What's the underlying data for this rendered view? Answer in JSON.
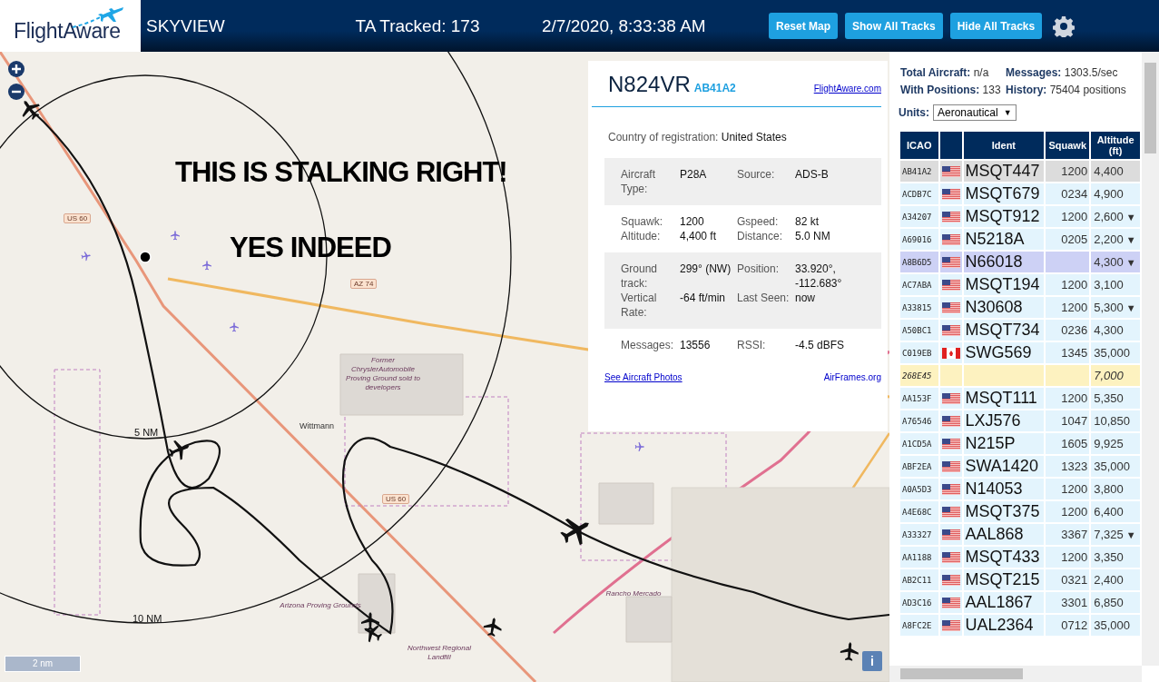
{
  "header": {
    "logo": "FlightAware",
    "title": "SKYVIEW",
    "tracked": "TA Tracked: 173",
    "datetime": "2/7/2020, 8:33:38 AM",
    "buttons": [
      "Reset Map",
      "Show All Tracks",
      "Hide All Tracks"
    ]
  },
  "map": {
    "overlay_texts": [
      "THIS IS STALKING RIGHT!",
      "YES INDEED"
    ],
    "range_labels": [
      "5 NM",
      "10 NM"
    ],
    "labels": [
      {
        "text": "US 60",
        "kind": "road"
      },
      {
        "text": "AZ 74",
        "kind": "road"
      },
      {
        "text": "US 60",
        "kind": "road"
      },
      {
        "text": "Wittmann",
        "kind": "place"
      },
      {
        "text": "Former ChryslerAutomobile Proving Ground sold to developers",
        "kind": "area"
      },
      {
        "text": "Rancho Mercado",
        "kind": "area"
      },
      {
        "text": "Northwest Regional Landfill",
        "kind": "area"
      },
      {
        "text": "Arizona Proving Grounds",
        "kind": "area"
      }
    ],
    "scale": "2 nm",
    "info_button": "i"
  },
  "info_panel": {
    "registration": "N824VR",
    "icao": "AB41A2",
    "link": "FlightAware.com",
    "country_label": "Country of registration:",
    "country": "United States",
    "groups": [
      {
        "shaded": true,
        "fields": [
          {
            "label": "Aircraft Type:",
            "value": "P28A"
          },
          {
            "label": "Source:",
            "value": "ADS-B"
          }
        ]
      },
      {
        "shaded": false,
        "fields": [
          {
            "label": "Squawk:",
            "value": "1200"
          },
          {
            "label": "Gspeed:",
            "value": "82 kt"
          },
          {
            "label": "Altitude:",
            "value": "4,400 ft"
          },
          {
            "label": "Distance:",
            "value": "5.0 NM"
          }
        ]
      },
      {
        "shaded": true,
        "fields": [
          {
            "label": "Ground track:",
            "value": "299° (NW)"
          },
          {
            "label": "Position:",
            "value": "33.920°, -112.683°"
          },
          {
            "label": "Vertical Rate:",
            "value": "-64 ft/min"
          },
          {
            "label": "Last Seen:",
            "value": "now"
          }
        ]
      },
      {
        "shaded": false,
        "fields": [
          {
            "label": "Messages:",
            "value": "13556"
          },
          {
            "label": "RSSI:",
            "value": "-4.5 dBFS"
          }
        ]
      }
    ],
    "photos_link": "See Aircraft Photos",
    "airframes_link": "AirFrames.org"
  },
  "sidebar": {
    "stats": [
      {
        "label": "Total Aircraft:",
        "value": "n/a"
      },
      {
        "label": "Messages:",
        "value": "1303.5/sec"
      },
      {
        "label": "With Positions:",
        "value": "133"
      },
      {
        "label": "History:",
        "value": "75404 positions"
      }
    ],
    "units_label": "Units:",
    "units_value": "Aeronautical",
    "units_caret": "▼",
    "columns": [
      "ICAO",
      "",
      "Ident",
      "Squawk",
      "Altitude (ft)"
    ],
    "rows": [
      {
        "icao": "AB41A2",
        "flag": {
          "kind": "us"
        },
        "ident": "MSQT447",
        "squawk": "1200",
        "altitude": "4,400",
        "trend": "",
        "selected": true,
        "kind": "normal"
      },
      {
        "icao": "ACDB7C",
        "flag": {
          "kind": "us"
        },
        "ident": "MSQT679",
        "squawk": "0234",
        "altitude": "4,900",
        "trend": "",
        "selected": false,
        "kind": "normal"
      },
      {
        "icao": "A34207",
        "flag": {
          "kind": "us"
        },
        "ident": "MSQT912",
        "squawk": "1200",
        "altitude": "2,600",
        "trend": "▼",
        "selected": false,
        "kind": "normal"
      },
      {
        "icao": "A69016",
        "flag": {
          "kind": "us"
        },
        "ident": "N5218A",
        "squawk": "0205",
        "altitude": "2,200",
        "trend": "▼",
        "selected": false,
        "kind": "normal"
      },
      {
        "icao": "A8B6D5",
        "flag": {
          "kind": "us"
        },
        "ident": "N66018",
        "squawk": "",
        "altitude": "4,300",
        "trend": "▼",
        "selected": false,
        "kind": "highlighted"
      },
      {
        "icao": "AC7ABA",
        "flag": {
          "kind": "us"
        },
        "ident": "MSQT194",
        "squawk": "1200",
        "altitude": "3,100",
        "trend": "",
        "selected": false,
        "kind": "normal"
      },
      {
        "icao": "A33815",
        "flag": {
          "kind": "us"
        },
        "ident": "N30608",
        "squawk": "1200",
        "altitude": "5,300",
        "trend": "▼",
        "selected": false,
        "kind": "normal"
      },
      {
        "icao": "A50BC1",
        "flag": {
          "kind": "us"
        },
        "ident": "MSQT734",
        "squawk": "0236",
        "altitude": "4,300",
        "trend": "",
        "selected": false,
        "kind": "normal"
      },
      {
        "icao": "C019EB",
        "flag": {
          "kind": "ca"
        },
        "ident": "SWG569",
        "squawk": "1345",
        "altitude": "35,000",
        "trend": "",
        "selected": false,
        "kind": "normal"
      },
      {
        "icao": "268E45",
        "ident": "",
        "squawk": "",
        "altitude": "7,000",
        "trend": "",
        "selected": false,
        "kind": "noposition"
      },
      {
        "icao": "AA153F",
        "flag": {
          "kind": "us"
        },
        "ident": "MSQT111",
        "squawk": "1200",
        "altitude": "5,350",
        "trend": "",
        "selected": false,
        "kind": "normal"
      },
      {
        "icao": "A76546",
        "flag": {
          "kind": "us"
        },
        "ident": "LXJ576",
        "squawk": "1047",
        "altitude": "10,850",
        "trend": "",
        "selected": false,
        "kind": "normal"
      },
      {
        "icao": "A1CD5A",
        "flag": {
          "kind": "us"
        },
        "ident": "N215P",
        "squawk": "1605",
        "altitude": "9,925",
        "trend": "",
        "selected": false,
        "kind": "normal"
      },
      {
        "icao": "ABF2EA",
        "flag": {
          "kind": "us"
        },
        "ident": "SWA1420",
        "squawk": "1323",
        "altitude": "35,000",
        "trend": "",
        "selected": false,
        "kind": "normal"
      },
      {
        "icao": "A0A5D3",
        "flag": {
          "kind": "us"
        },
        "ident": "N14053",
        "squawk": "1200",
        "altitude": "3,800",
        "trend": "",
        "selected": false,
        "kind": "normal"
      },
      {
        "icao": "A4E68C",
        "flag": {
          "kind": "us"
        },
        "ident": "MSQT375",
        "squawk": "1200",
        "altitude": "6,400",
        "trend": "",
        "selected": false,
        "kind": "normal"
      },
      {
        "icao": "A33327",
        "flag": {
          "kind": "us"
        },
        "ident": "AAL868",
        "squawk": "3367",
        "altitude": "7,325",
        "trend": "▼",
        "selected": false,
        "kind": "normal"
      },
      {
        "icao": "AA1188",
        "flag": {
          "kind": "us"
        },
        "ident": "MSQT433",
        "squawk": "1200",
        "altitude": "3,350",
        "trend": "",
        "selected": false,
        "kind": "normal"
      },
      {
        "icao": "AB2C11",
        "flag": {
          "kind": "us"
        },
        "ident": "MSQT215",
        "squawk": "0321",
        "altitude": "2,400",
        "trend": "",
        "selected": false,
        "kind": "normal"
      },
      {
        "icao": "AD3C16",
        "flag": {
          "kind": "us"
        },
        "ident": "AAL1867",
        "squawk": "3301",
        "altitude": "6,850",
        "trend": "",
        "selected": false,
        "kind": "normal"
      },
      {
        "icao": "A8FC2E",
        "flag": {
          "kind": "us"
        },
        "ident": "UAL2364",
        "squawk": "0712",
        "altitude": "35,000",
        "trend": "",
        "selected": false,
        "kind": "normal"
      }
    ]
  }
}
